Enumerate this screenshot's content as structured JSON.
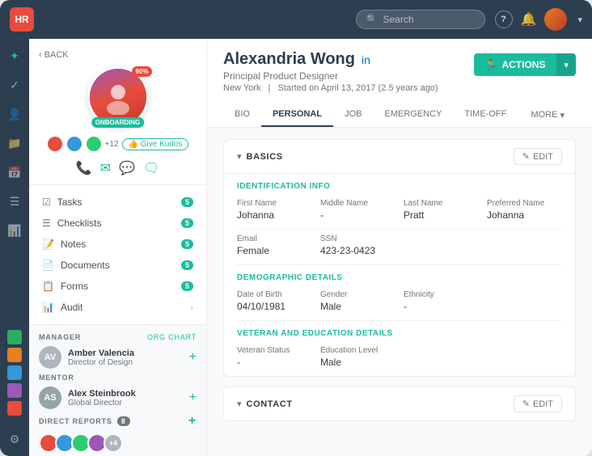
{
  "app": {
    "logo": "HR",
    "search_placeholder": "Search"
  },
  "topnav": {
    "help_icon": "?",
    "bell_icon": "🔔",
    "chevron": "▾"
  },
  "left_panel": {
    "back_label": "BACK",
    "profile": {
      "name": "Alexandria Wong",
      "title": "Principal Product Designer",
      "location": "New York",
      "start_date": "Started on April 13, 2017 (2.5 years ago)",
      "status_badge": "ONBOARDING",
      "progress": "90%",
      "kudos_count": "+12",
      "give_kudos_label": "👍 Give Kudos"
    },
    "nav_items": [
      {
        "icon": "☑",
        "label": "Tasks",
        "badge": "5"
      },
      {
        "icon": "☰",
        "label": "Checklists",
        "badge": "5"
      },
      {
        "icon": "📝",
        "label": "Notes",
        "badge": "5"
      },
      {
        "icon": "📄",
        "label": "Documents",
        "badge": "5"
      },
      {
        "icon": "📋",
        "label": "Forms",
        "badge": "5"
      },
      {
        "icon": "📊",
        "label": "Audit",
        "arrow": "›"
      }
    ],
    "manager": {
      "section_title": "MANAGER",
      "org_chart_label": "Org Chart",
      "name": "Amber Valencia",
      "title": "Director of Design",
      "avatar_bg": "#adb5bd"
    },
    "mentor": {
      "section_title": "MENTOR",
      "name": "Alex Steinbrook",
      "title": "Global Director",
      "avatar_bg": "#6c757d"
    },
    "direct_reports": {
      "section_title": "DIRECT REPORTS",
      "count": "8",
      "avatars": [
        {
          "bg": "#e74c3c"
        },
        {
          "bg": "#3498db"
        },
        {
          "bg": "#2ecc71"
        },
        {
          "bg": "#9b59b6"
        }
      ],
      "overflow": "+4"
    }
  },
  "main_content": {
    "employee_name": "Alexandria Wong",
    "employee_title": "Principal Product Designer",
    "location": "New York",
    "start_info": "Started on April 13, 2017 (2.5 years ago)",
    "separator": "|",
    "actions_label": "ACTIONS",
    "tabs": [
      {
        "label": "BIO",
        "active": false
      },
      {
        "label": "PERSONAL",
        "active": true
      },
      {
        "label": "JOB",
        "active": false
      },
      {
        "label": "EMERGENCY",
        "active": false
      },
      {
        "label": "TIME-OFF",
        "active": false
      }
    ],
    "more_label": "MORE",
    "basics_section": {
      "title": "BASICS",
      "edit_label": "EDIT",
      "identification_title": "IDENTIFICATION INFO",
      "fields_row1": [
        {
          "label": "First Name",
          "value": "Johanna"
        },
        {
          "label": "Middle Name",
          "value": "-"
        },
        {
          "label": "Last Name",
          "value": "Pratt"
        },
        {
          "label": "Preferred Name",
          "value": "Johanna"
        }
      ],
      "fields_row2": [
        {
          "label": "Email",
          "value": "Female"
        },
        {
          "label": "SSN",
          "value": "423-23-0423"
        }
      ],
      "demographic_title": "DEMOGRAPHIC DETAILS",
      "demo_fields": [
        {
          "label": "Date of Birth",
          "value": "04/10/1981"
        },
        {
          "label": "Gender",
          "value": "Male"
        },
        {
          "label": "Ethnicity",
          "value": "-"
        }
      ],
      "veteran_title": "VETERAN AND EDUCATION DETAILS",
      "veteran_fields": [
        {
          "label": "Veteran Status",
          "value": "-"
        },
        {
          "label": "Education Level",
          "value": "Male"
        }
      ]
    },
    "contact_section": {
      "title": "CONTACT",
      "edit_label": "EDIT"
    }
  },
  "sidebar_icons": [
    {
      "icon": "✦",
      "active": true
    },
    {
      "icon": "✓",
      "active": false
    },
    {
      "icon": "👤",
      "active": false
    },
    {
      "icon": "📁",
      "active": false
    },
    {
      "icon": "📅",
      "active": false
    },
    {
      "icon": "☰",
      "active": false
    },
    {
      "icon": "📊",
      "active": false
    },
    {
      "icon": "⚙",
      "active": false
    }
  ]
}
